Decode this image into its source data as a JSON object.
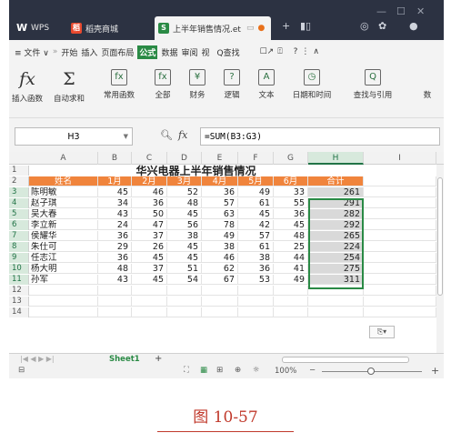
{
  "titlebar": {
    "tabs": [
      {
        "label": "WPS",
        "icon": "wps-logo-icon"
      },
      {
        "label": "稻壳商城",
        "icon": "daoke-icon"
      },
      {
        "label": "上半年销售情况.et",
        "icon": "sheet-file-icon"
      }
    ]
  },
  "menubar": {
    "items": [
      "≡ 文件 ∨",
      "»",
      "开始",
      "插入",
      "页面布局",
      "公式",
      "数据",
      "审阅",
      "视",
      "Q查找"
    ],
    "active": "公式"
  },
  "ribbon": {
    "items": [
      {
        "label": "插入函数",
        "icon": "fx"
      },
      {
        "label": "自动求和",
        "icon": "Σ"
      },
      {
        "label": "常用函数",
        "icon": "fx"
      },
      {
        "label": "全部",
        "icon": "fx"
      },
      {
        "label": "财务",
        "icon": "¥"
      },
      {
        "label": "逻辑",
        "icon": "?"
      },
      {
        "label": "文本",
        "icon": "A"
      },
      {
        "label": "日期和时间",
        "icon": "◷"
      },
      {
        "label": "查找与引用",
        "icon": "Q"
      },
      {
        "label": "数",
        "icon": ""
      }
    ]
  },
  "formula_bar": {
    "name_box": "H3",
    "fx_label": "fx",
    "formula": "=SUM(B3:G3)"
  },
  "sheet": {
    "columns": [
      "A",
      "B",
      "C",
      "D",
      "E",
      "F",
      "G",
      "H",
      "I"
    ],
    "selected_column": "H",
    "row_numbers": [
      "1",
      "2",
      "3",
      "4",
      "5",
      "6",
      "7",
      "8",
      "9",
      "10",
      "11",
      "12",
      "13",
      "14"
    ],
    "title": "华兴电器上半年销售情况",
    "headers": [
      "姓名",
      "1月",
      "2月",
      "3月",
      "4月",
      "5月",
      "6月",
      "合计"
    ],
    "rows": [
      {
        "name": "陈明敏",
        "values": [
          45,
          46,
          52,
          36,
          49,
          33
        ],
        "total": 261
      },
      {
        "name": "赵子琪",
        "values": [
          34,
          36,
          48,
          57,
          61,
          55
        ],
        "total": 291
      },
      {
        "name": "吴大春",
        "values": [
          43,
          50,
          45,
          63,
          45,
          36
        ],
        "total": 282
      },
      {
        "name": "李立新",
        "values": [
          24,
          47,
          56,
          78,
          42,
          45
        ],
        "total": 292
      },
      {
        "name": "侯耀华",
        "values": [
          36,
          37,
          38,
          49,
          57,
          48
        ],
        "total": 265
      },
      {
        "name": "朱仕可",
        "values": [
          29,
          26,
          45,
          38,
          61,
          25
        ],
        "total": 224
      },
      {
        "name": "任志江",
        "values": [
          36,
          45,
          45,
          46,
          38,
          44
        ],
        "total": 254
      },
      {
        "name": "杨大明",
        "values": [
          48,
          37,
          51,
          62,
          36,
          41
        ],
        "total": 275
      },
      {
        "name": "孙军",
        "values": [
          43,
          45,
          54,
          67,
          53,
          49
        ],
        "total": 311
      }
    ],
    "tab_name": "Sheet1",
    "add_tab": "+"
  },
  "statusbar": {
    "zoom": "100%"
  },
  "caption": "图 10-57",
  "colors": {
    "header_orange": "#f0843c",
    "accent_green": "#2a8a45",
    "titlebar_dark": "#2c3242"
  }
}
